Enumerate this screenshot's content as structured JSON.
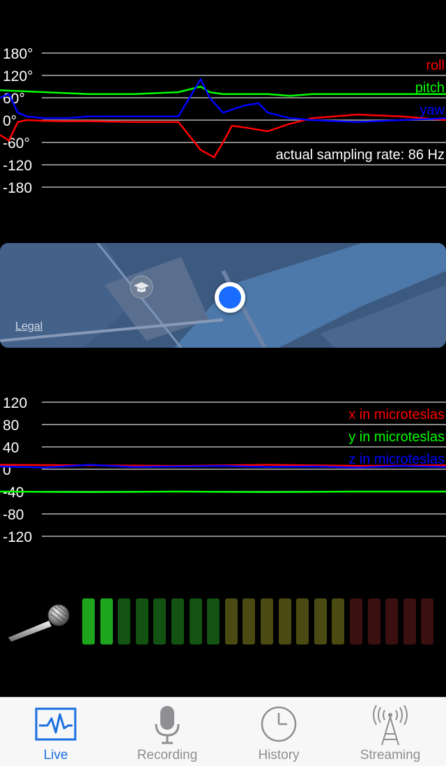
{
  "orientation_chart": {
    "y_ticks": [
      "180°",
      "120°",
      "60°",
      "0°",
      "-60°",
      "-120",
      "-180"
    ],
    "legend": {
      "roll": "roll",
      "pitch": "pitch",
      "yaw": "yaw"
    },
    "sampling_rate_text": "actual sampling rate: 86 Hz"
  },
  "magnet_chart": {
    "y_ticks": [
      "120",
      "80",
      "40",
      "0",
      "-40",
      "-80",
      "-120"
    ],
    "legend": {
      "x": "x in microteslas",
      "y": "y in microteslas",
      "z": "z in microteslas"
    }
  },
  "map": {
    "legal": "Legal"
  },
  "tabs": [
    {
      "label": "Live",
      "icon": "pulse-icon"
    },
    {
      "label": "Recording",
      "icon": "microphone-icon"
    },
    {
      "label": "History",
      "icon": "clock-icon"
    },
    {
      "label": "Streaming",
      "icon": "broadcast-tower-icon"
    }
  ],
  "colors": {
    "roll": "#ff0000",
    "pitch": "#00ff00",
    "yaw": "#0000ff",
    "accent": "#1a6fe0"
  },
  "chart_data": [
    {
      "type": "line",
      "ylim": [
        -180,
        180
      ],
      "ylabel": "",
      "xlabel": "",
      "series": [
        {
          "name": "roll",
          "x": [
            0,
            2,
            4,
            6,
            10,
            15,
            20,
            30,
            40,
            45,
            48,
            50,
            52,
            55,
            60,
            65,
            70,
            80,
            90,
            100
          ],
          "values": [
            -40,
            -55,
            -5,
            0,
            -2,
            -3,
            -3,
            -5,
            -5,
            -80,
            -100,
            -60,
            -15,
            -20,
            -30,
            -10,
            5,
            15,
            10,
            0
          ]
        },
        {
          "name": "pitch",
          "x": [
            0,
            10,
            20,
            30,
            40,
            45,
            47,
            50,
            55,
            60,
            65,
            70,
            80,
            90,
            100
          ],
          "values": [
            80,
            75,
            70,
            70,
            75,
            90,
            75,
            70,
            70,
            70,
            65,
            70,
            70,
            70,
            70
          ]
        },
        {
          "name": "yaw",
          "x": [
            0,
            2,
            4,
            6,
            10,
            15,
            20,
            30,
            40,
            45,
            47,
            50,
            55,
            58,
            60,
            65,
            70,
            80,
            90,
            100
          ],
          "values": [
            60,
            70,
            20,
            10,
            5,
            5,
            10,
            10,
            10,
            110,
            60,
            20,
            40,
            45,
            20,
            5,
            0,
            -5,
            0,
            5
          ]
        }
      ]
    },
    {
      "type": "line",
      "ylim": [
        -140,
        140
      ],
      "ylabel": "",
      "xlabel": "",
      "series": [
        {
          "name": "x in microteslas",
          "x": [
            0,
            20,
            40,
            60,
            80,
            100
          ],
          "values": [
            8,
            7,
            6,
            8,
            6,
            7
          ]
        },
        {
          "name": "y in microteslas",
          "x": [
            0,
            20,
            40,
            60,
            80,
            100
          ],
          "values": [
            -40,
            -41,
            -40,
            -41,
            -40,
            -40
          ]
        },
        {
          "name": "z in microteslas",
          "x": [
            0,
            10,
            20,
            30,
            40,
            50,
            60,
            70,
            80,
            90,
            100
          ],
          "values": [
            5,
            3,
            8,
            4,
            5,
            6,
            4,
            5,
            3,
            6,
            4
          ]
        }
      ]
    }
  ]
}
